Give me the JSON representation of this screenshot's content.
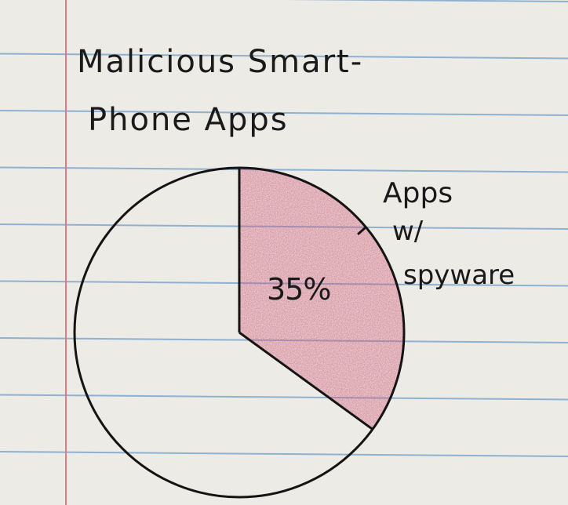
{
  "paper": {
    "background": "#ecebe6",
    "rule_color": "#8fb0cf",
    "margin_color": "#e07a86"
  },
  "chart_data": {
    "type": "pie",
    "title_line1": "Malicious Smart-",
    "title_line2": "Phone Apps",
    "slices": [
      {
        "label_lines": [
          "Apps",
          "w/",
          "spyware"
        ],
        "value": 35,
        "value_label": "35%",
        "color": "#cf5a78"
      },
      {
        "label_lines": [],
        "value": 65,
        "value_label": "",
        "color": "none"
      }
    ],
    "legend": "none",
    "grid": false
  }
}
